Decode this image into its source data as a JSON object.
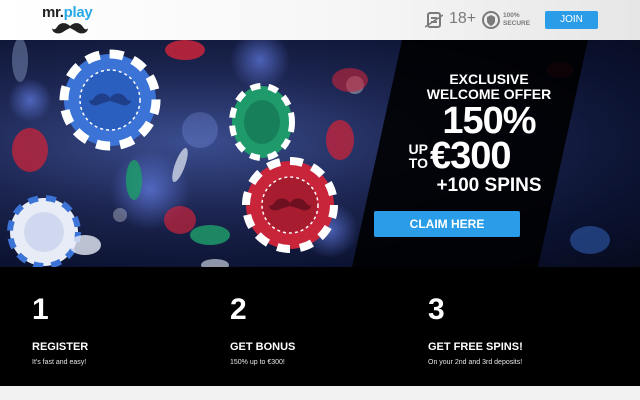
{
  "header": {
    "logo": {
      "word": "mr.",
      "highlight": "play"
    },
    "age_label": "18+",
    "secure_label_line1": "100%",
    "secure_label_line2": "SECURE",
    "join_label": "JOIN"
  },
  "hero": {
    "offer_line1": "EXCLUSIVE",
    "offer_line2": "WELCOME OFFER",
    "offer_percent": "150%",
    "offer_up": "UP",
    "offer_to": "TO",
    "offer_amount": "€300",
    "offer_spins": "+100 SPINS",
    "claim_label": "CLAIM HERE"
  },
  "steps": [
    {
      "number": "1",
      "title": "REGISTER",
      "description": "It's fast and easy!"
    },
    {
      "number": "2",
      "title": "GET BONUS",
      "description": "150% up to €300!"
    },
    {
      "number": "3",
      "title": "GET FREE SPINS!",
      "description": "On your 2nd and 3rd deposits!"
    }
  ],
  "colors": {
    "brand_blue": "#2b9de8",
    "steps_background": "#000000",
    "hero_background": "#0b1230",
    "chip_blue": "#3b74d6",
    "chip_green": "#1f9a6a",
    "chip_red": "#c8243a"
  },
  "icons": {
    "logo_mark": "mustache-icon",
    "age": "age-restriction-icon",
    "secure": "shield-icon",
    "hero_art": "casino-chips-illustration"
  }
}
